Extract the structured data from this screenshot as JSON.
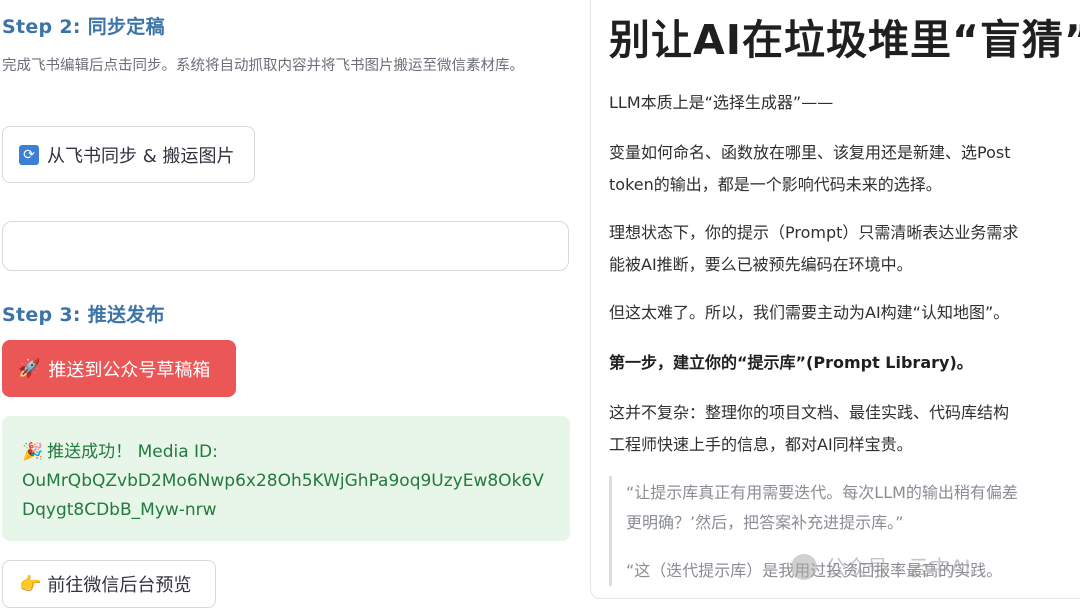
{
  "step2": {
    "title": "Step 2: 同步定稿",
    "description": "完成飞书编辑后点击同步。系统将自动抓取内容并将飞书图片搬运至微信素材库。",
    "sync_button_label": "从飞书同步 & 搬运图片",
    "sync_icon": "refresh-icon"
  },
  "step3": {
    "title": "Step 3: 推送发布",
    "push_button_label": "推送到公众号草稿箱",
    "push_icon": "rocket-icon",
    "success_message": "推送成功！ Media ID:",
    "media_id": "OuMrQbQZvbD2Mo6Nwp6x28Oh5KWjGhPa9oq9UzyEw8Ok6VDqygt8CDbB_Myw-nrw",
    "success_icon": "party-popper-icon",
    "preview_button_label": "前往微信后台预览",
    "preview_icon": "pointing-hand-icon"
  },
  "article": {
    "title": "别让AI在垃圾堆里“盲猜”",
    "paragraphs": [
      "LLM本质上是“选择生成器”——",
      "变量如何命名、函数放在哪里、该复用还是新建、选Post",
      "token的输出，都是一个影响代码未来的选择。",
      "理想状态下，你的提示（Prompt）只需清晰表达业务需求",
      "能被AI推断，要么已被预先编码在环境中。",
      "但这太难了。所以，我们需要主动为AI构建“认知地图”。",
      "第一步，建立你的“提示库”(Prompt Library)。",
      "这并不复杂：整理你的项目文档、最佳实践、代码库结构",
      "工程师快速上手的信息，都对AI同样宝贵。"
    ],
    "quote": [
      "“让提示库真正有用需要迭代。每次LLM的输出稍有偏差",
      "更明确？’然后，把答案补充进提示库。”",
      "“这（迭代提示库）是我用过投资回报率最高的实践。"
    ],
    "watermark": "公众号 · 云中AI"
  },
  "colors": {
    "step_title": "#3d74a8",
    "push_button": "#eb5656",
    "success_bg": "#e8f5e9",
    "success_text": "#237a3e"
  }
}
